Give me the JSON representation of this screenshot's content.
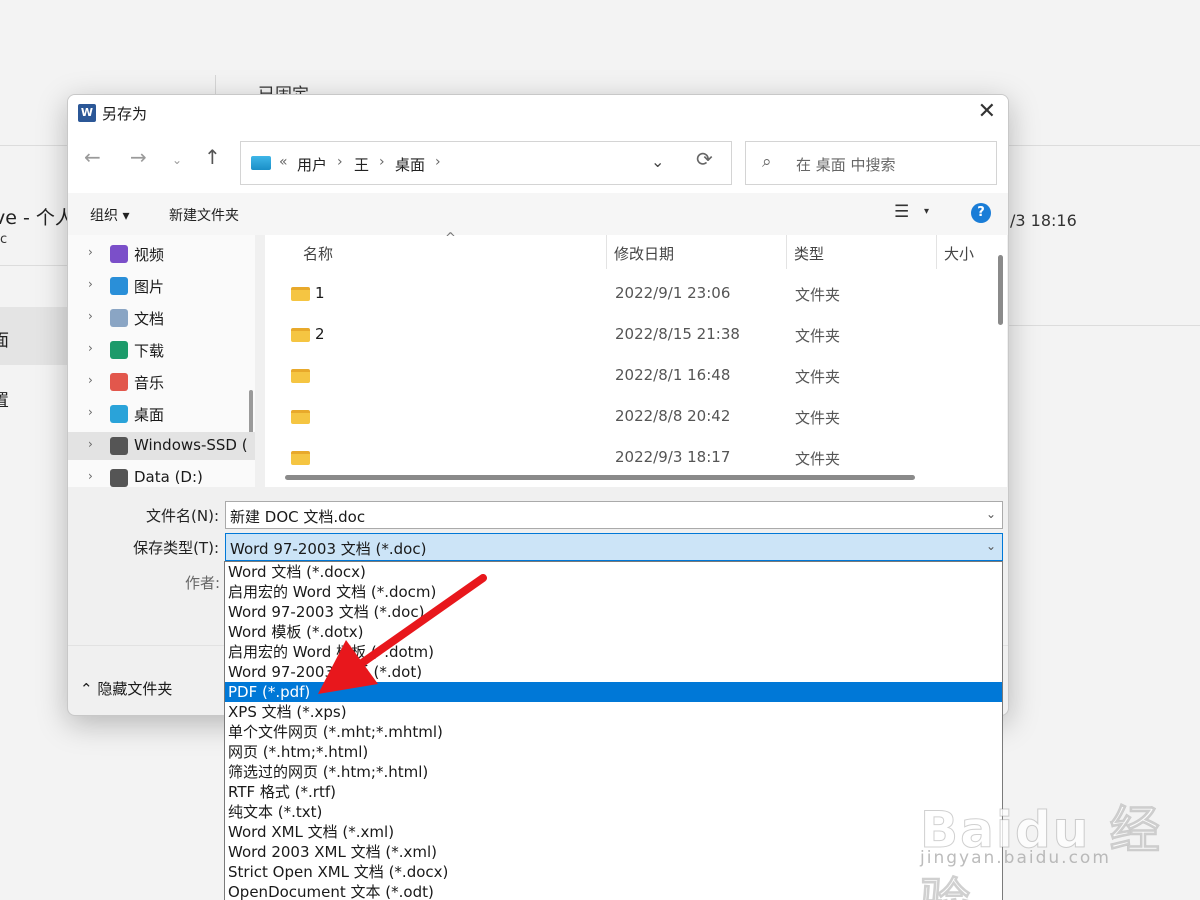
{
  "background": {
    "pinned_heading": "已固定",
    "onedrive_title": "ve - 个人",
    "onedrive_sub": "c",
    "row_date": "/3 18:16",
    "selected_item": "面",
    "item2": "置"
  },
  "dialog": {
    "title": "另存为",
    "app_icon_letter": "W",
    "close": "✕"
  },
  "nav": {
    "back": "←",
    "forward": "→",
    "recent": "⌄",
    "up": "↑",
    "breadcrumb": [
      "«",
      "用户",
      "王",
      "桌面"
    ],
    "separator": "›",
    "history_chevron": "⌄",
    "refresh": "⟳",
    "search_placeholder": "在 桌面 中搜索"
  },
  "toolbar": {
    "organize": "组织 ▾",
    "new_folder": "新建文件夹",
    "view_icon": "☰",
    "view_dropdown": "▾",
    "help": "?"
  },
  "navpane": {
    "items": [
      {
        "label": "视频",
        "icon": "video-icon",
        "color": "#7b4fc9"
      },
      {
        "label": "图片",
        "icon": "pictures-icon",
        "color": "#2a8fd8"
      },
      {
        "label": "文档",
        "icon": "documents-icon",
        "color": "#8aa5c4"
      },
      {
        "label": "下载",
        "icon": "download-icon",
        "color": "#1c9a6a"
      },
      {
        "label": "音乐",
        "icon": "music-icon",
        "color": "#e2574c"
      },
      {
        "label": "桌面",
        "icon": "desktop-icon",
        "color": "#2aa3d9"
      },
      {
        "label": "Windows-SSD (",
        "icon": "drive-icon",
        "color": "#555555"
      },
      {
        "label": "Data (D:)",
        "icon": "drive-icon",
        "color": "#555555"
      }
    ],
    "expand_arrow": "›"
  },
  "files": {
    "columns": [
      "名称",
      "修改日期",
      "类型",
      "大小"
    ],
    "sort_indicator": "^",
    "rows": [
      {
        "name": "1",
        "date": "2022/9/1 23:06",
        "type": "文件夹"
      },
      {
        "name": "2",
        "date": "2022/8/15 21:38",
        "type": "文件夹"
      },
      {
        "name": "",
        "date": "2022/8/1 16:48",
        "type": "文件夹"
      },
      {
        "name": "",
        "date": "2022/8/8 20:42",
        "type": "文件夹"
      },
      {
        "name": "",
        "date": "2022/9/3 18:17",
        "type": "文件夹"
      }
    ]
  },
  "form": {
    "filename_label": "文件名(N):",
    "filename_value": "新建 DOC 文档.doc",
    "savetype_label": "保存类型(T):",
    "savetype_value": "Word 97-2003 文档 (*.doc)",
    "author_label": "作者:",
    "dropdown_chevron": "⌄",
    "hide_folders": "⌃ 隐藏文件夹"
  },
  "type_options": [
    "Word 文档 (*.docx)",
    "启用宏的 Word 文档 (*.docm)",
    "Word 97-2003 文档 (*.doc)",
    "Word 模板 (*.dotx)",
    "启用宏的 Word 模板 (*.dotm)",
    "Word 97-2003 模板 (*.dot)",
    "PDF (*.pdf)",
    "XPS 文档 (*.xps)",
    "单个文件网页 (*.mht;*.mhtml)",
    "网页 (*.htm;*.html)",
    "筛选过的网页 (*.htm;*.html)",
    "RTF 格式 (*.rtf)",
    "纯文本 (*.txt)",
    "Word XML 文档 (*.xml)",
    "Word 2003 XML 文档 (*.xml)",
    "Strict Open XML 文档 (*.docx)",
    "OpenDocument 文本 (*.odt)"
  ],
  "highlighted_option_index": 6,
  "watermark": {
    "brand": "Baidu 经验",
    "url": "jingyan.baidu.com"
  },
  "colors": {
    "accent": "#0078d7",
    "arrow": "#e8171c"
  }
}
